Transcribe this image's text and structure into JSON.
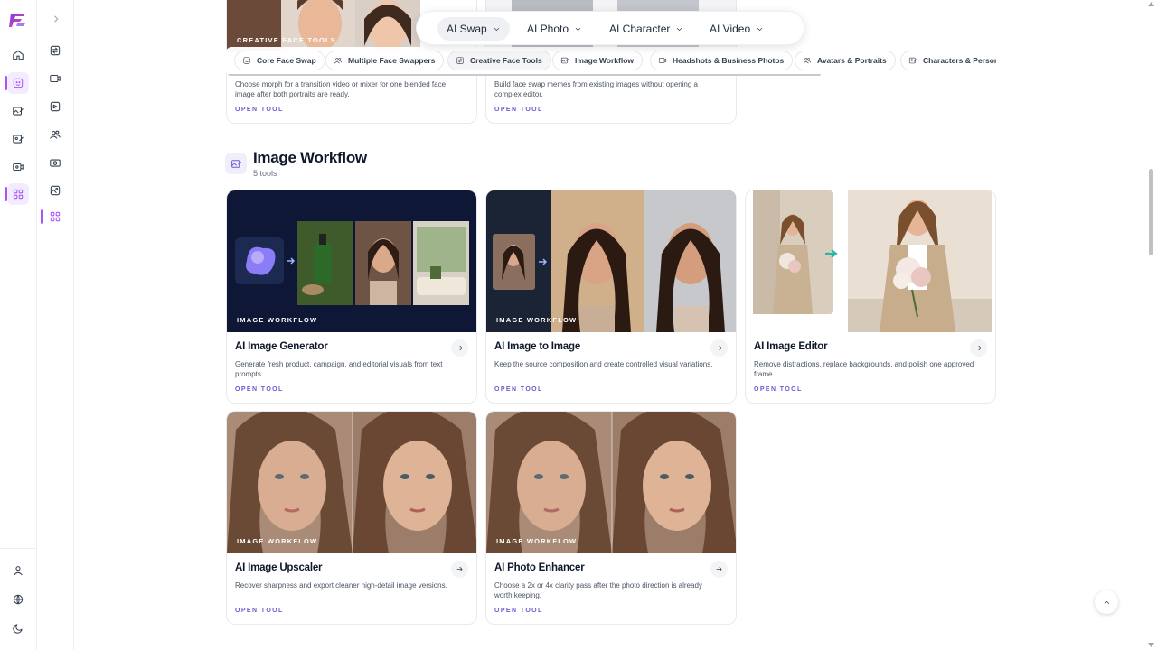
{
  "nav": {
    "items": [
      {
        "label": "AI Swap",
        "active": true
      },
      {
        "label": "AI Photo",
        "active": false
      },
      {
        "label": "AI Character",
        "active": false
      },
      {
        "label": "AI Video",
        "active": false
      }
    ]
  },
  "tabs": [
    {
      "label": "Core Face Swap",
      "icon": "face-icon"
    },
    {
      "label": "Multiple Face Swappers",
      "icon": "users-icon"
    },
    {
      "label": "Creative Face Tools",
      "icon": "sparkle-icon",
      "active": true
    },
    {
      "label": "Image Workflow",
      "icon": "image-edit-icon"
    },
    {
      "label": "Headshots & Business Photos",
      "icon": "id-card-icon"
    },
    {
      "label": "Avatars & Portraits",
      "icon": "users-icon"
    },
    {
      "label": "Characters & Persor",
      "icon": "character-icon"
    }
  ],
  "top_cards": [
    {
      "badge": "CREATIVE FACE TOOLS",
      "desc": "Choose morph for a transition video or mixer for one blended face image after both portraits are ready.",
      "open": "OPEN TOOL"
    },
    {
      "badge": "",
      "desc": "Build face swap memes from existing images without opening a complex editor.",
      "open": "OPEN TOOL"
    }
  ],
  "section": {
    "title": "Image Workflow",
    "count": "5 tools"
  },
  "cards": [
    {
      "badge": "IMAGE WORKFLOW",
      "title": "AI Image Generator",
      "desc": "Generate fresh product, campaign, and editorial visuals from text prompts.",
      "open": "OPEN TOOL"
    },
    {
      "badge": "IMAGE WORKFLOW",
      "title": "AI Image to Image",
      "desc": "Keep the source composition and create controlled visual variations.",
      "open": "OPEN TOOL"
    },
    {
      "badge": "",
      "title": "AI Image Editor",
      "desc": "Remove distractions, replace backgrounds, and polish one approved frame.",
      "open": "OPEN TOOL"
    },
    {
      "badge": "IMAGE WORKFLOW",
      "title": "AI Image Upscaler",
      "desc": "Recover sharpness and export cleaner high-detail image versions.",
      "open": "OPEN TOOL"
    },
    {
      "badge": "IMAGE WORKFLOW",
      "title": "AI Photo Enhancer",
      "desc": "Choose a 2x or 4x clarity pass after the photo direction is already worth keeping.",
      "open": "OPEN TOOL"
    }
  ],
  "colors": {
    "accent": "#a855f7",
    "link": "#6d5bd0",
    "border": "#e8eaee"
  }
}
